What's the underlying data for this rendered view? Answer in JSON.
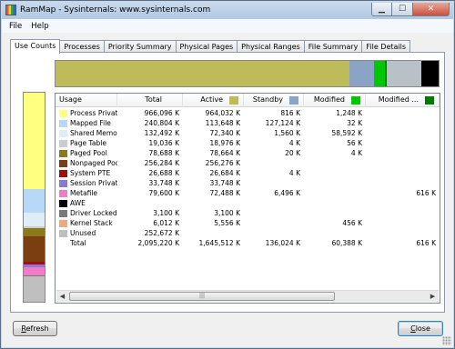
{
  "window": {
    "title": "RamMap - Sysinternals: www.sysinternals.com"
  },
  "menu": [
    "File",
    "Help"
  ],
  "tabs": [
    "Use Counts",
    "Processes",
    "Priority Summary",
    "Physical Pages",
    "Physical Ranges",
    "File Summary",
    "File Details"
  ],
  "active_tab": 0,
  "columns": [
    {
      "label": "Usage",
      "color": null
    },
    {
      "label": "Total",
      "color": null
    },
    {
      "label": "Active",
      "color": "#bebc5a"
    },
    {
      "label": "Standby",
      "color": "#8ba4c6"
    },
    {
      "label": "Modified",
      "color": "#00c800"
    },
    {
      "label": "Modified ...",
      "color": "#007a00"
    }
  ],
  "rows": [
    {
      "usage": "Process Private",
      "color": "#ffff80",
      "total": "966,096 K",
      "active": "964,032 K",
      "standby": "816 K",
      "modified": "1,248 K",
      "modified_nw": ""
    },
    {
      "usage": "Mapped File",
      "color": "#b8d8f8",
      "total": "240,804 K",
      "active": "113,648 K",
      "standby": "127,124 K",
      "modified": "32 K",
      "modified_nw": ""
    },
    {
      "usage": "Shared Memory",
      "color": "#e0ecf8",
      "total": "132,492 K",
      "active": "72,340 K",
      "standby": "1,560 K",
      "modified": "58,592 K",
      "modified_nw": ""
    },
    {
      "usage": "Page Table",
      "color": "#cccccc",
      "total": "19,036 K",
      "active": "18,976 K",
      "standby": "4 K",
      "modified": "56 K",
      "modified_nw": ""
    },
    {
      "usage": "Paged Pool",
      "color": "#8a7a1a",
      "total": "78,688 K",
      "active": "78,664 K",
      "standby": "20 K",
      "modified": "4 K",
      "modified_nw": ""
    },
    {
      "usage": "Nonpaged Pool",
      "color": "#7a3e10",
      "total": "256,284 K",
      "active": "256,276 K",
      "standby": "",
      "modified": "",
      "modified_nw": ""
    },
    {
      "usage": "System PTE",
      "color": "#a01010",
      "total": "26,688 K",
      "active": "26,684 K",
      "standby": "4 K",
      "modified": "",
      "modified_nw": ""
    },
    {
      "usage": "Session Private",
      "color": "#8a7ad8",
      "total": "33,748 K",
      "active": "33,748 K",
      "standby": "",
      "modified": "",
      "modified_nw": ""
    },
    {
      "usage": "Metafile",
      "color": "#f07cc8",
      "total": "79,600 K",
      "active": "72,488 K",
      "standby": "6,496 K",
      "modified": "",
      "modified_nw": "616 K"
    },
    {
      "usage": "AWE",
      "color": "#000000",
      "total": "",
      "active": "",
      "standby": "",
      "modified": "",
      "modified_nw": ""
    },
    {
      "usage": "Driver Locked",
      "color": "#7a7a7a",
      "total": "3,100 K",
      "active": "3,100 K",
      "standby": "",
      "modified": "",
      "modified_nw": ""
    },
    {
      "usage": "Kernel Stack",
      "color": "#f0a878",
      "total": "6,012 K",
      "active": "5,556 K",
      "standby": "",
      "modified": "456 K",
      "modified_nw": ""
    },
    {
      "usage": "Unused",
      "color": "#bfbfbf",
      "total": "252,672 K",
      "active": "",
      "standby": "",
      "modified": "",
      "modified_nw": ""
    },
    {
      "usage": "Total",
      "color": null,
      "total": "2,095,220 K",
      "active": "1,645,512 K",
      "standby": "136,024 K",
      "modified": "60,388 K",
      "modified_nw": "616 K"
    }
  ],
  "top_bar": [
    {
      "name": "active",
      "color": "#bebc5a",
      "fraction": 0.768
    },
    {
      "name": "standby",
      "color": "#8ba4c6",
      "fraction": 0.063
    },
    {
      "name": "modified",
      "color": "#00c800",
      "fraction": 0.028
    },
    {
      "name": "modified-no-write",
      "color": "#007a00",
      "fraction": 0.005
    },
    {
      "name": "free",
      "color": "#b8c0c8",
      "fraction": 0.09
    },
    {
      "name": "zeroed",
      "color": "#000000",
      "fraction": 0.046
    }
  ],
  "vertical_bar": [
    {
      "name": "process-private",
      "color": "#ffff80",
      "fraction": 0.461
    },
    {
      "name": "mapped-file",
      "color": "#b8d8f8",
      "fraction": 0.115
    },
    {
      "name": "shared-memory",
      "color": "#e0ecf8",
      "fraction": 0.063
    },
    {
      "name": "page-table",
      "color": "#cccccc",
      "fraction": 0.009
    },
    {
      "name": "paged-pool",
      "color": "#8a7a1a",
      "fraction": 0.038
    },
    {
      "name": "nonpaged-pool",
      "color": "#7a3e10",
      "fraction": 0.122
    },
    {
      "name": "system-pte",
      "color": "#a01010",
      "fraction": 0.013
    },
    {
      "name": "session-private",
      "color": "#8a7ad8",
      "fraction": 0.016
    },
    {
      "name": "metafile",
      "color": "#f07cc8",
      "fraction": 0.038
    },
    {
      "name": "driver-locked",
      "color": "#7a7a7a",
      "fraction": 0.0015
    },
    {
      "name": "kernel-stack",
      "color": "#f0a878",
      "fraction": 0.003
    },
    {
      "name": "unused",
      "color": "#bfbfbf",
      "fraction": 0.1205
    }
  ],
  "buttons": {
    "refresh": {
      "underline": "R",
      "rest": "efresh"
    },
    "close": {
      "underline": "C",
      "rest": "lose"
    }
  }
}
